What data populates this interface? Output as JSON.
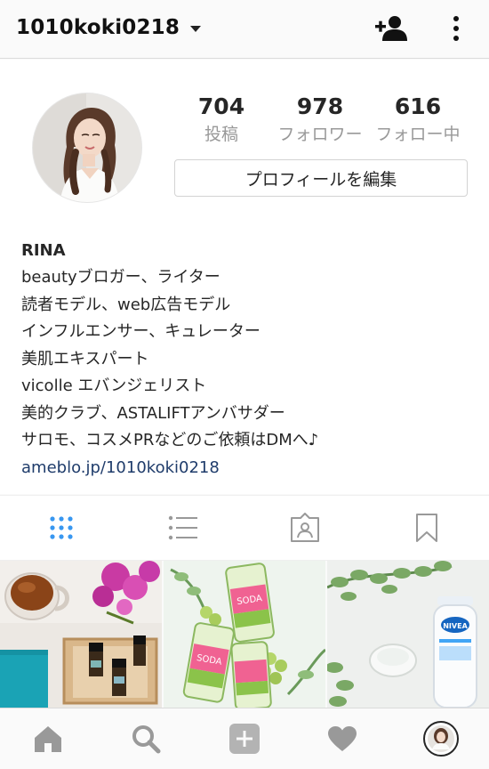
{
  "header": {
    "username": "1010koki0218"
  },
  "icons": {
    "dropdown": "caret-down-icon",
    "add_person": "add-person-icon",
    "more": "more-vertical-icon"
  },
  "stats": [
    {
      "value": "704",
      "label": "投稿"
    },
    {
      "value": "978",
      "label": "フォロワー"
    },
    {
      "value": "616",
      "label": "フォロー中"
    }
  ],
  "edit_profile_label": "プロフィールを編集",
  "bio": {
    "name": "RINA",
    "lines": [
      "beautyブロガー、ライター",
      "読者モデル、web広告モデル",
      "インフルエンサー、キュレーター",
      "美肌エキスパート",
      "vicolle エバンジェリスト",
      "美的クラブ、ASTALIFTアンバサダー",
      "サロモ、コスメPRなどのご依頼はDMへ♪"
    ],
    "link": "ameblo.jp/1010koki0218"
  },
  "tabs": [
    {
      "name": "grid-view",
      "icon": "grid-icon",
      "active": true
    },
    {
      "name": "list-view",
      "icon": "list-icon",
      "active": false
    },
    {
      "name": "tagged",
      "icon": "tagged-person-icon",
      "active": false
    },
    {
      "name": "saved",
      "icon": "bookmark-icon",
      "active": false
    }
  ],
  "grid_posts": [
    {
      "subject": "tea cup, essential oil bottles and orchid flowers"
    },
    {
      "subject": "green sparkling drink cans with grapes"
    },
    {
      "subject": "NIVEA Refresh Plus bottle with glass and leaves"
    }
  ],
  "bottom_nav": [
    {
      "icon": "home-icon"
    },
    {
      "icon": "search-icon"
    },
    {
      "icon": "add-post-icon"
    },
    {
      "icon": "heart-icon"
    },
    {
      "icon": "profile-avatar-icon"
    }
  ],
  "colors": {
    "accent_blue": "#3897f0",
    "link_blue": "#1f3c6b",
    "secondary_text": "#999999",
    "border": "#dbdbdb"
  }
}
